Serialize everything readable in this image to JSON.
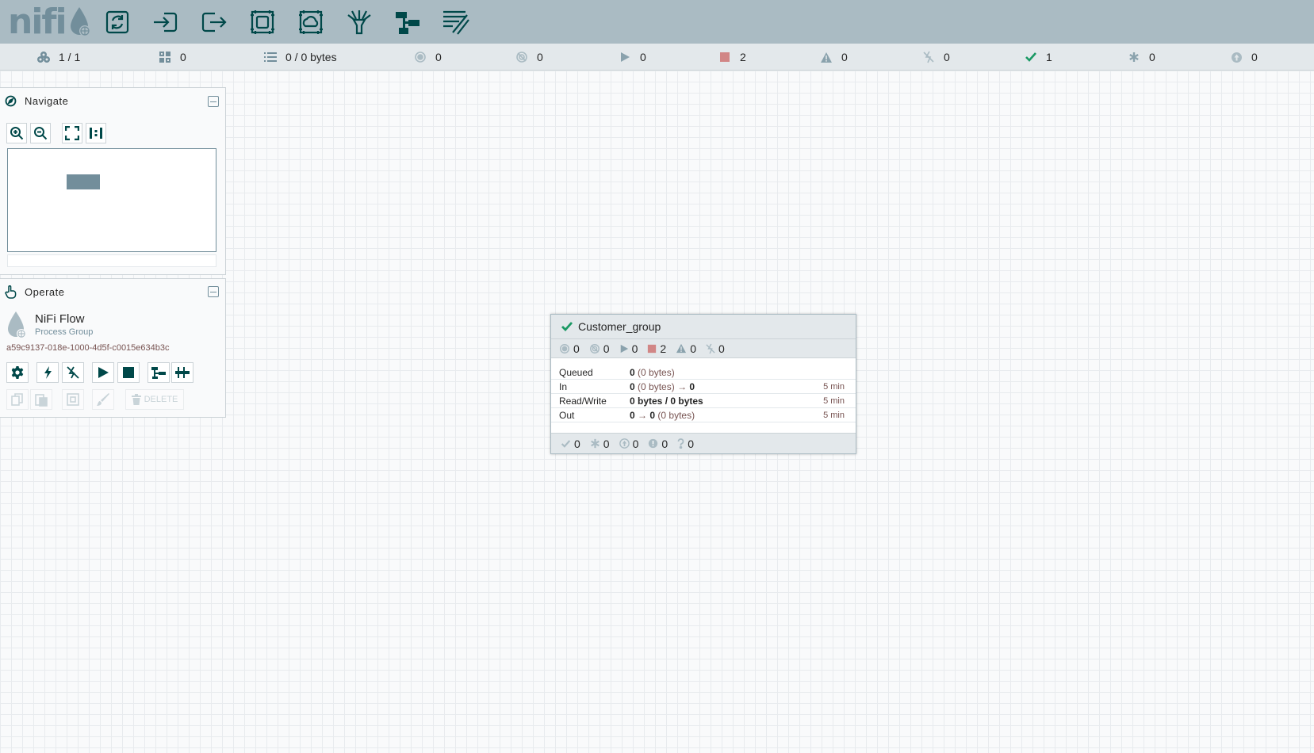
{
  "header": {
    "logo_text": "nifi",
    "toolbar": [
      {
        "name": "processor-button",
        "icon": "processor-icon"
      },
      {
        "name": "input-port-button",
        "icon": "input-port-icon"
      },
      {
        "name": "output-port-button",
        "icon": "output-port-icon"
      },
      {
        "name": "process-group-button",
        "icon": "process-group-icon"
      },
      {
        "name": "remote-process-group-button",
        "icon": "remote-process-group-icon"
      },
      {
        "name": "funnel-button",
        "icon": "funnel-icon"
      },
      {
        "name": "template-button",
        "icon": "template-icon"
      },
      {
        "name": "label-button",
        "icon": "label-icon"
      }
    ]
  },
  "status": {
    "cluster": "1 / 1",
    "threads": "0",
    "queued": "0 / 0 bytes",
    "transmitting": "0",
    "not_transmitting": "0",
    "running": "0",
    "stopped": "2",
    "invalid": "0",
    "disabled": "0",
    "up_to_date": "1",
    "locally_modified": "0",
    "sync_failure": "0"
  },
  "colors": {
    "header_bg": "#aabbc3",
    "icon_dark": "#004849",
    "stopped_red": "#d18686",
    "up_to_date_green": "#1a9964"
  },
  "navigate": {
    "title": "Navigate"
  },
  "operate": {
    "title": "Operate",
    "component_name": "NiFi Flow",
    "component_type": "Process Group",
    "component_id": "a59c9137-018e-1000-4d5f-c0015e634b3c",
    "delete_label": "DELETE"
  },
  "process_group": {
    "name": "Customer_group",
    "counts": {
      "transmitting": "0",
      "not_transmitting": "0",
      "running": "0",
      "stopped": "2",
      "invalid": "0",
      "disabled": "0"
    },
    "stats": {
      "queued_label": "Queued",
      "queued_count": "0",
      "queued_size": "(0 bytes)",
      "in_label": "In",
      "in_count": "0",
      "in_size": "(0 bytes)",
      "in_arrow": "→",
      "in_ports": "0",
      "in_time": "5 min",
      "rw_label": "Read/Write",
      "rw_value": "0 bytes / 0 bytes",
      "rw_time": "5 min",
      "out_label": "Out",
      "out_ports": "0",
      "out_arrow": "→",
      "out_count": "0",
      "out_size": "(0 bytes)",
      "out_time": "5 min"
    },
    "versions": {
      "up_to_date": "0",
      "locally_modified": "0",
      "stale": "0",
      "modified_stale": "0",
      "sync_failure": "0"
    }
  }
}
